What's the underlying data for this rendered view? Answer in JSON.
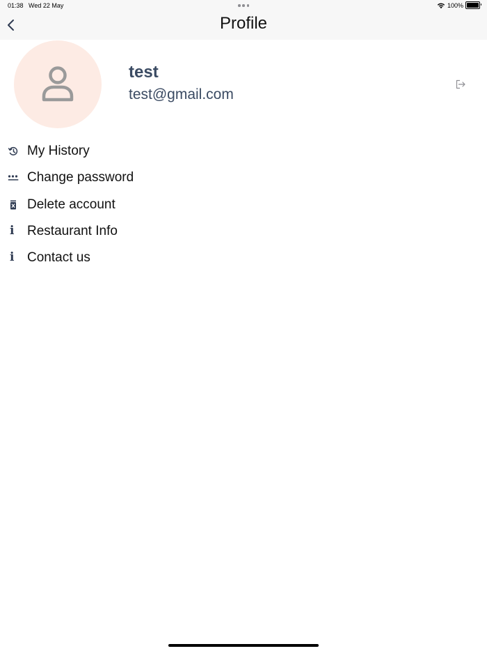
{
  "status_bar": {
    "time": "01:38",
    "date": "Wed 22 May",
    "battery_percent": "100%"
  },
  "nav": {
    "title": "Profile",
    "back_icon": "chevron-left-icon"
  },
  "profile": {
    "name": "test",
    "email": "test@gmail.com",
    "avatar_icon": "person-icon",
    "avatar_bg": "#fdebe4",
    "logout_icon": "logout-icon"
  },
  "menu": {
    "items": [
      {
        "label": "My History",
        "icon": "history-icon"
      },
      {
        "label": "Change password",
        "icon": "password-dots-icon"
      },
      {
        "label": "Delete account",
        "icon": "trash-icon"
      },
      {
        "label": "Restaurant Info",
        "icon": "info-icon"
      },
      {
        "label": "Contact us",
        "icon": "info-icon"
      }
    ]
  },
  "colors": {
    "text_primary": "#111111",
    "text_profile": "#3b4b63",
    "icon": "#2f3b52",
    "header_bg": "#f7f7f7"
  }
}
